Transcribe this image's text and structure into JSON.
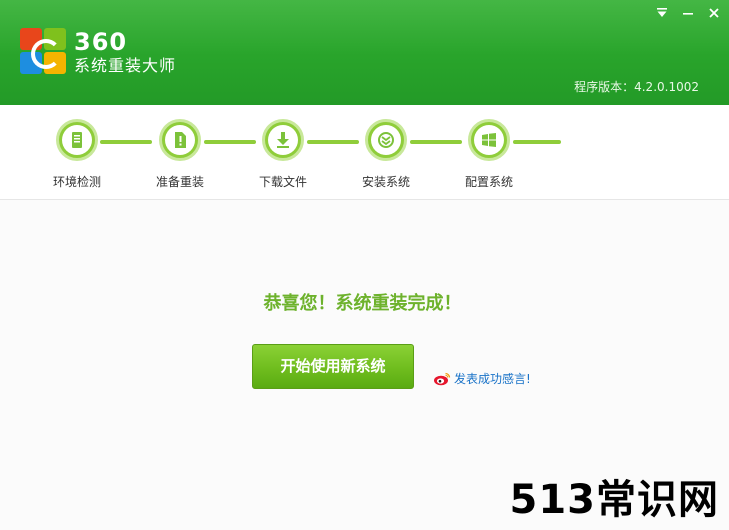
{
  "header": {
    "brand_number": "360",
    "brand_name": "系统重装大师",
    "version": "程序版本：4.2.0.1002"
  },
  "window_controls": [
    "menu-icon",
    "minimize-icon",
    "close-icon"
  ],
  "steps": [
    {
      "label": "环境检测",
      "icon": "monitor-icon"
    },
    {
      "label": "准备重装",
      "icon": "document-icon"
    },
    {
      "label": "下载文件",
      "icon": "download-icon"
    },
    {
      "label": "安装系统",
      "icon": "install-icon"
    },
    {
      "label": "配置系统",
      "icon": "windows-icon"
    }
  ],
  "main": {
    "congrats": "恭喜您！系统重装完成！",
    "start_button": "开始使用新系统",
    "share_link": "发表成功感言!"
  },
  "watermark": "513常识网",
  "colors": {
    "header_green": "#2aa62c",
    "step_green": "#8fcd3a",
    "text_green": "#6db22c",
    "link_blue": "#1a73c8"
  }
}
